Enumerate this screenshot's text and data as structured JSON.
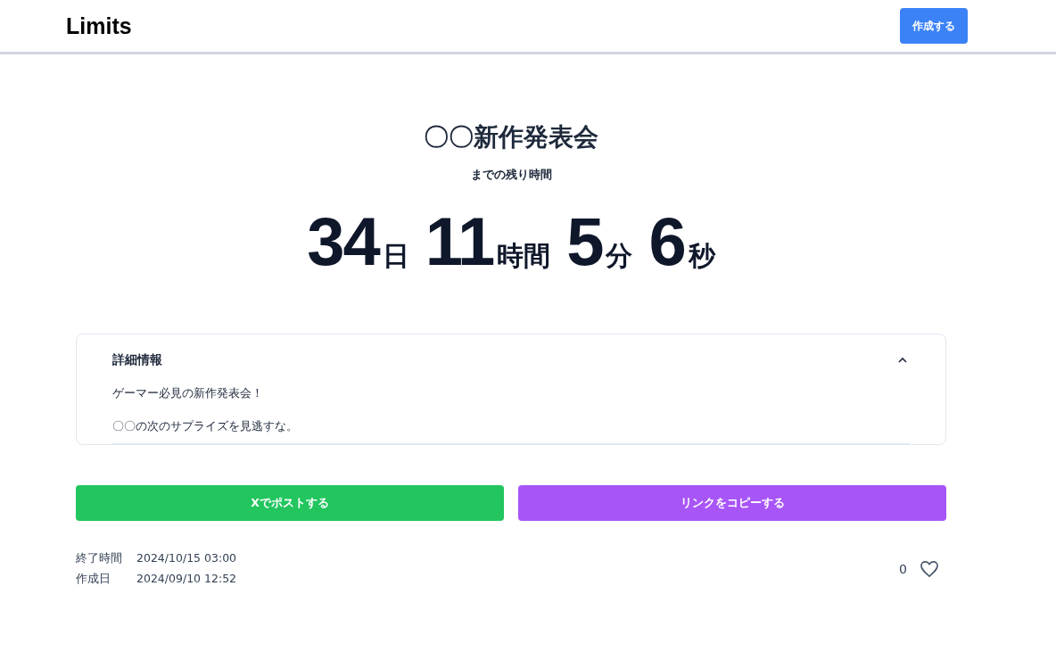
{
  "header": {
    "logo": "Limits",
    "create_button": "作成する"
  },
  "event": {
    "title": "〇〇新作発表会",
    "subtitle": "までの残り時間"
  },
  "countdown": [
    {
      "value": "34",
      "unit": "日"
    },
    {
      "value": "11",
      "unit": "時間"
    },
    {
      "value": "5",
      "unit": "分"
    },
    {
      "value": "6",
      "unit": "秒"
    }
  ],
  "details": {
    "title": "詳細情報",
    "expanded": true,
    "paragraphs": [
      "ゲーマー必見の新作発表会！",
      "〇〇の次のサプライズを見逃すな。"
    ]
  },
  "actions": [
    {
      "label": "Xでポストする",
      "kind": "post"
    },
    {
      "label": "リンクをコピーする",
      "kind": "copy"
    }
  ],
  "meta": [
    {
      "label": "終了時間",
      "value": "2024/10/15 03:00"
    },
    {
      "label": "作成日",
      "value": "2024/09/10 12:52"
    }
  ],
  "likes": {
    "count": "0",
    "liked": false
  }
}
